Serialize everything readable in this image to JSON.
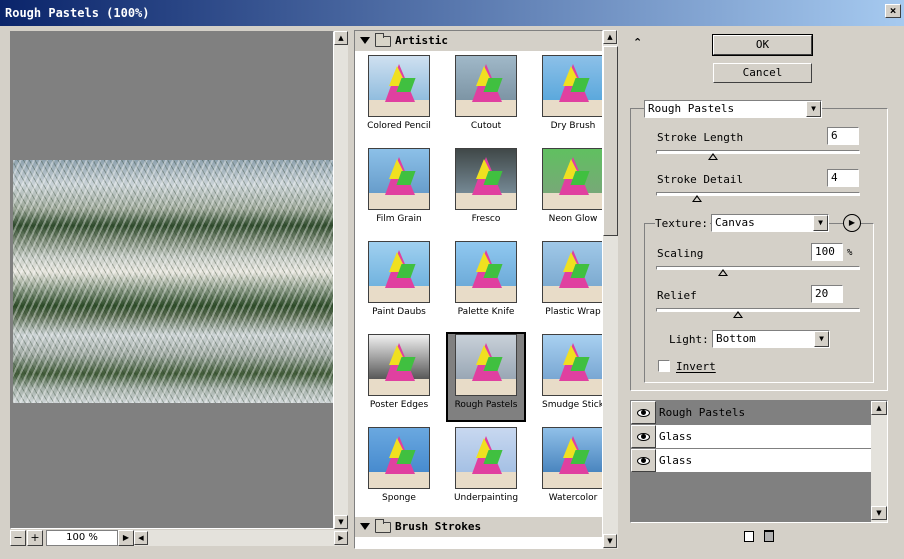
{
  "window": {
    "title": "Rough Pastels (100%)"
  },
  "preview": {
    "zoom_level": "100 %",
    "zoom_out": "−",
    "zoom_in": "+"
  },
  "gallery": {
    "categories": [
      {
        "name": "Artistic",
        "filters": [
          "Colored Pencil",
          "Cutout",
          "Dry Brush",
          "Film Grain",
          "Fresco",
          "Neon Glow",
          "Paint Daubs",
          "Palette Knife",
          "Plastic Wrap",
          "Poster Edges",
          "Rough Pastels",
          "Smudge Stick",
          "Sponge",
          "Underpainting",
          "Watercolor"
        ],
        "selected": "Rough Pastels"
      },
      {
        "name": "Brush Strokes"
      }
    ]
  },
  "buttons": {
    "ok": "OK",
    "cancel": "Cancel"
  },
  "settings": {
    "filter_select": "Rough Pastels",
    "stroke_length": {
      "label": "Stroke Length",
      "value": "6",
      "fraction": 0.28
    },
    "stroke_detail": {
      "label": "Stroke Detail",
      "value": "4",
      "fraction": 0.2
    },
    "texture": {
      "label": "Texture:",
      "value": "Canvas"
    },
    "scaling": {
      "label": "Scaling",
      "value": "100",
      "unit": "%",
      "fraction": 0.33
    },
    "relief": {
      "label": "Relief",
      "value": "20",
      "fraction": 0.4
    },
    "light": {
      "label": "Light:",
      "value": "Bottom"
    },
    "invert": {
      "label": "Invert",
      "checked": false
    }
  },
  "layers": [
    {
      "name": "Rough Pastels",
      "active": true
    },
    {
      "name": "Glass",
      "active": false
    },
    {
      "name": "Glass",
      "active": false
    }
  ],
  "colors": {
    "titlebar_start": "#0a246a",
    "titlebar_end": "#a6caf0",
    "dialog_bg": "#d4d0c8",
    "selected_bg": "#808080"
  }
}
